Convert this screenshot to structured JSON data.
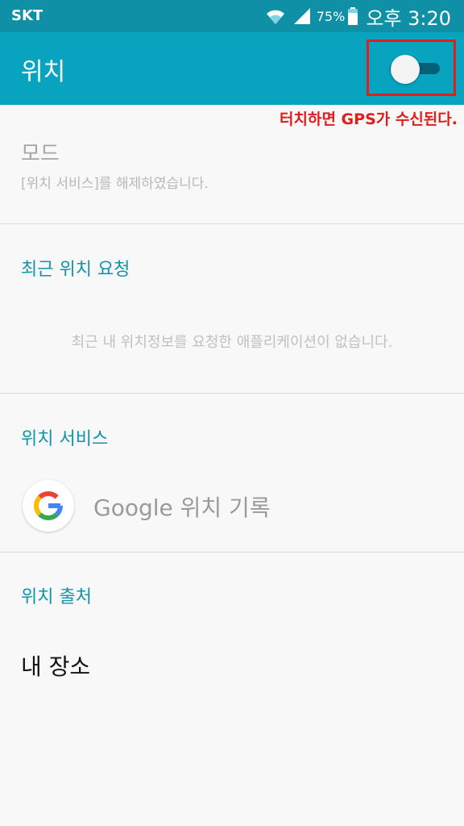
{
  "status_bar": {
    "carrier": "SKT",
    "battery_percent": "75%",
    "time": "오후 3:20",
    "icons": [
      "wifi-icon",
      "signal-icon",
      "battery-icon"
    ]
  },
  "app_bar": {
    "title": "위치",
    "location_toggle_on": false
  },
  "annotation": "터치하면 GPS가 수신된다.",
  "mode": {
    "title": "모드",
    "subtitle": "[위치 서비스]를 해제하였습니다."
  },
  "recent_requests": {
    "header": "최근 위치 요청",
    "empty_message": "최근 내 위치정보를 요청한 애플리케이션이 없습니다."
  },
  "location_services": {
    "header": "위치 서비스",
    "google_item": "Google 위치 기록"
  },
  "location_sources": {
    "header": "위치 출처",
    "my_places": "내 장소"
  },
  "colors": {
    "status_bar": "#0f90a7",
    "app_bar": "#08a3bf",
    "accent_text": "#1193a9",
    "annotation": "#e31b1b"
  }
}
